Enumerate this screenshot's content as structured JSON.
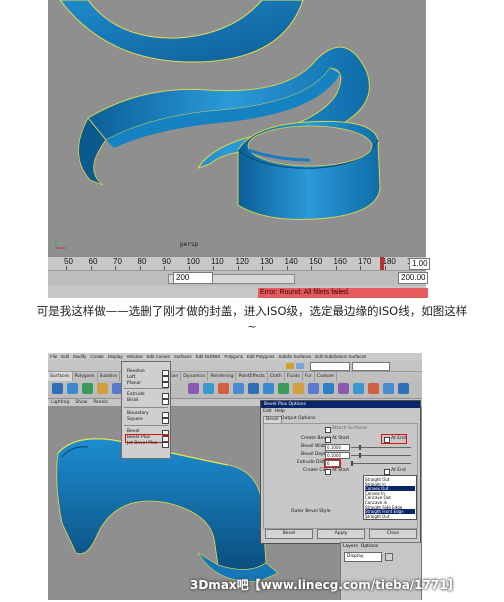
{
  "top_viewport": {
    "camera_label": "persp",
    "timeline_ticks": [
      "50",
      "60",
      "70",
      "80",
      "90",
      "100",
      "110",
      "120",
      "130",
      "140",
      "150",
      "160",
      "170",
      "180",
      "190"
    ],
    "current_frame": "1.00",
    "range_start": "200",
    "range_end": "200.00",
    "status_error": "Error: Round: All fillets failed."
  },
  "caption": {
    "line1": "可是我这样做——选删了刚才做的封盖，进入ISO级，选定最边缘的ISO线，如图这样",
    "line2": "~"
  },
  "maya_ui": {
    "menubar": [
      "File",
      "Edit",
      "Modify",
      "Create",
      "Display",
      "Window",
      "Edit Curves",
      "Surfaces",
      "Edit NURBS",
      "Polygons",
      "Edit Polygons",
      "Subdiv Surfaces",
      "Edit Subdivision Surfaces"
    ],
    "shelf_tabs": [
      "Surfaces",
      "Polygons",
      "Subdivs",
      "Deformation",
      "Animation",
      "Dynamics",
      "Rendering",
      "PaintEffects",
      "Cloth",
      "Fluids",
      "Fur",
      "Custom"
    ],
    "panel_menu": [
      "Lighting",
      "Show",
      "Panels"
    ],
    "surfaces_menu": {
      "items": [
        "Revolve",
        "Loft",
        "Planar",
        "Extrude",
        "Birail",
        "Boundary",
        "Square",
        "Bevel",
        "Bevel Plus",
        "Jot Bevel Plus"
      ],
      "highlighted": "Bevel Plus"
    },
    "bevel_dialog": {
      "title": "Bevel Plus Options",
      "menu": [
        "Edit",
        "Help"
      ],
      "tabs": [
        "Bevel",
        "Output Options"
      ],
      "attach_surfaces": "Attach Surfaces",
      "create_bevel_label": "Create Bevel",
      "at_start": "At Start",
      "at_end": "At End",
      "bevel_width_label": "Bevel Width",
      "bevel_width": "0.1000",
      "bevel_depth_label": "Bevel Depth",
      "bevel_depth": "0.1000",
      "extrude_distance_label": "Extrude Distance",
      "extrude_distance": "0",
      "create_cap_label": "Create Cap",
      "cap_at_start": "At Start",
      "cap_at_end": "At End",
      "outer_bevel_style_label": "Outer Bevel Style",
      "styles": [
        "Straight Out",
        "Straight In",
        "Convex Out",
        "Convex In",
        "Concave Out",
        "Concave In",
        "Straight Side Edge",
        "Straight Front Edge",
        "Straight Out",
        "Straight In",
        "Convex Out",
        "Convex In"
      ],
      "selected_style": "Convex Out",
      "buttons": {
        "bevel": "Bevel",
        "apply": "Apply",
        "close": "Close"
      }
    },
    "layers_panel": {
      "menu": [
        "Layers",
        "Options"
      ],
      "display": "Display"
    }
  },
  "watermark": "3Dmax吧【www.linecg.com/tieba/1771】",
  "colors": {
    "surface_blue": "#1e88c8",
    "viewport_gray": "#8f8f8f",
    "error_red": "#e55a5a",
    "highlight_red": "#e01010",
    "selection_navy": "#0a246a"
  }
}
